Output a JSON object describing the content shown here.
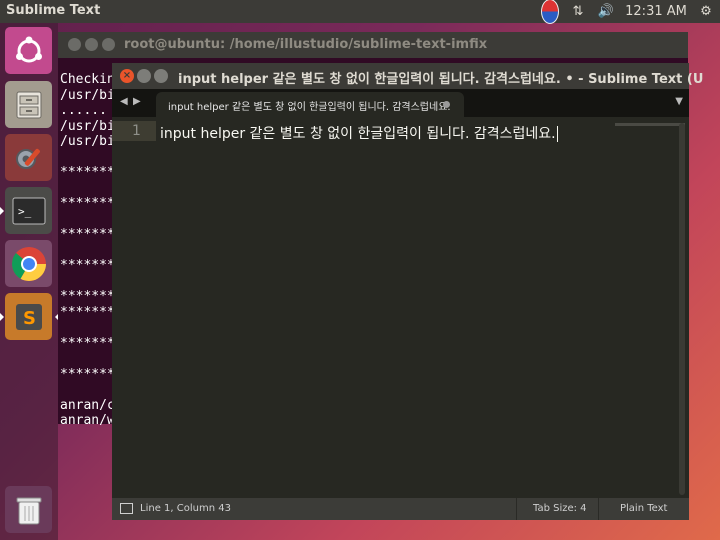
{
  "top_panel": {
    "app_title": "Sublime Text",
    "clock": "12:31 AM",
    "icons": [
      "keyboard-input-icon",
      "network-icon",
      "volume-icon",
      "settings-gear-icon"
    ]
  },
  "launcher": {
    "items": [
      "ubuntu-dash",
      "files",
      "system-settings",
      "terminal",
      "chrome",
      "sublime-text",
      "trash"
    ]
  },
  "terminal": {
    "title": "root@ubuntu: /home/illustudio/sublime-text-imfix",
    "lines": [
      "Checkin",
      "/usr/bi",
      "......",
      "/usr/bi",
      "/usr/bi",
      "",
      "*******",
      "",
      "*******",
      "",
      "*******",
      "",
      "*******",
      "",
      "*******",
      "*******",
      "",
      "*******",
      "",
      "*******",
      "",
      "anran/c",
      "anran/w"
    ]
  },
  "sublime": {
    "title": "input helper 같은 별도 창 없이 한글입력이 됩니다. 감격스럽네요. • - Sublime Text (U",
    "tab_label": "input helper 같은 별도 창 없이 한글입력이 됩니다. 감격스럽네요.",
    "line_number": "1",
    "code_line": "input helper 같은 별도 창 없이 한글입력이 됩니다. 감격스럽네요.",
    "status": {
      "position": "Line 1, Column 43",
      "tab_size": "Tab Size: 4",
      "syntax": "Plain Text"
    }
  },
  "colors": {
    "editor_bg": "#272822",
    "panel_bg": "#3c3b37",
    "close_button": "#e9542a"
  }
}
